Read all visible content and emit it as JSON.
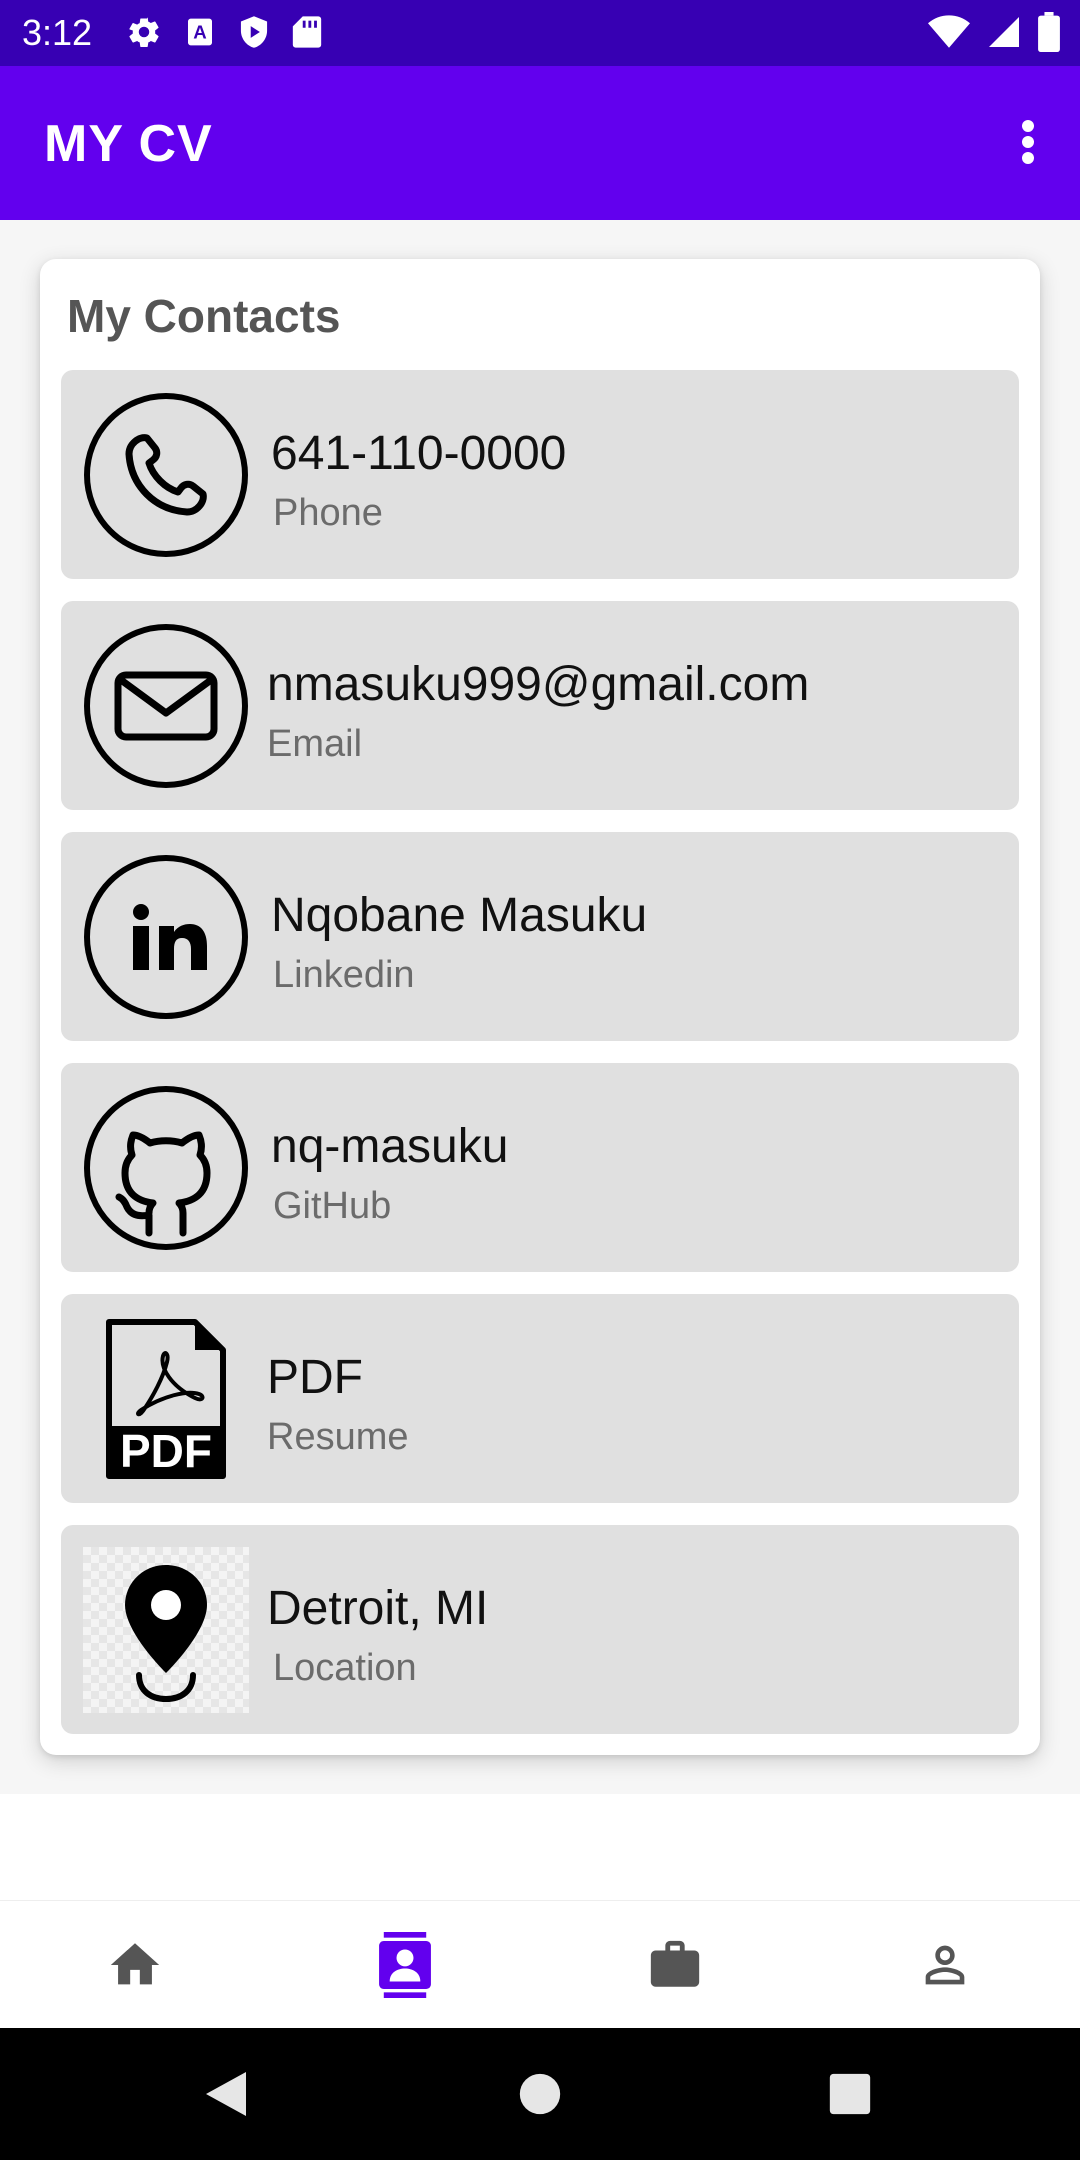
{
  "status_bar": {
    "time": "3:12",
    "left_icons": [
      "settings-icon",
      "font-a-icon",
      "play-protect-icon",
      "sd-card-icon"
    ],
    "right_icons": [
      "wifi-icon",
      "signal-icon",
      "battery-icon"
    ]
  },
  "app_bar": {
    "title": "MY CV",
    "overflow_icon": "more-vert-icon"
  },
  "contacts_card": {
    "title": "My Contacts",
    "items": [
      {
        "value": "641-110-0000",
        "label": "Phone",
        "icon": "phone-icon"
      },
      {
        "value": "nmasuku999@gmail.com",
        "label": "Email",
        "icon": "email-icon"
      },
      {
        "value": "Nqobane Masuku",
        "label": "Linkedin",
        "icon": "linkedin-icon"
      },
      {
        "value": "nq-masuku",
        "label": "GitHub",
        "icon": "github-icon"
      },
      {
        "value": "PDF",
        "label": "Resume",
        "icon": "pdf-icon"
      },
      {
        "value": "Detroit, MI",
        "label": "Location",
        "icon": "location-pin-icon"
      }
    ]
  },
  "bottom_nav": {
    "items": [
      {
        "icon": "home-icon",
        "active": false
      },
      {
        "icon": "contact-card-icon",
        "active": true
      },
      {
        "icon": "briefcase-icon",
        "active": false
      },
      {
        "icon": "person-icon",
        "active": false
      }
    ],
    "active_color": "#6200EE",
    "inactive_color": "#555555"
  },
  "system_nav": {
    "buttons": [
      "back-icon",
      "home-circle-icon",
      "recents-icon"
    ]
  },
  "colors": {
    "status_bar": "#3700B3",
    "app_bar": "#6200EE",
    "row_background": "#E0E0E0"
  }
}
